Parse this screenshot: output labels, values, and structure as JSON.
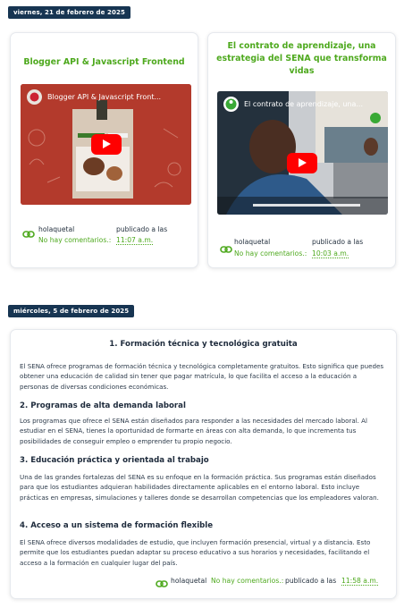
{
  "colors": {
    "accent": "#4ea91e",
    "badge": "#173552",
    "text": "#1e2b3c"
  },
  "date1": "viernes, 21 de febrero de 2025",
  "posts": [
    {
      "title": "Blogger API & Javascript Frontend",
      "video_title": "Blogger API & Javascript Front...",
      "author": "holaquetal",
      "comments": "No hay comentarios.:",
      "published_label": "publicado a las",
      "time": "11:07 a.m."
    },
    {
      "title": "El contrato de aprendizaje, una estrategia del SENA que transforma vidas",
      "video_title": "El contrato de aprendizaje, una...",
      "author": "holaquetal",
      "comments": "No hay comentarios.:",
      "published_label": "publicado a las",
      "time": "10:03 a.m."
    }
  ],
  "date2": "miércoles, 5 de febrero de 2025",
  "article": {
    "sections": [
      {
        "heading": "1. Formación técnica y tecnológica gratuita",
        "body": "El SENA ofrece programas de formación técnica y tecnológica completamente gratuitos. Esto significa que puedes obtener una educación de calidad sin tener que pagar matrícula, lo que facilita el acceso a la educación a personas de diversas condiciones económicas."
      },
      {
        "heading": "2. Programas de alta demanda laboral",
        "body": "Los programas que ofrece el SENA están diseñados para responder a las necesidades del mercado laboral. Al estudiar en el SENA, tienes la oportunidad de formarte en áreas con alta demanda, lo que incrementa tus posibilidades de conseguir empleo o emprender tu propio negocio."
      },
      {
        "heading": "3. Educación práctica y orientada al trabajo",
        "body": "Una de las grandes fortalezas del SENA es su enfoque en la formación práctica. Sus programas están diseñados para que los estudiantes adquieran habilidades directamente aplicables en el entorno laboral. Esto incluye prácticas en empresas, simulaciones y talleres donde se desarrollan competencias que los empleadores valoran."
      },
      {
        "heading": "4. Acceso a un sistema de formación flexible",
        "body": "El SENA ofrece diversos modalidades de estudio, que incluyen formación presencial, virtual y a distancia. Esto permite que los estudiantes puedan adaptar su proceso educativo a sus horarios y necesidades, facilitando el acceso a la formación en cualquier lugar del país."
      }
    ],
    "author": "holaquetal",
    "comments": "No hay comentarios.:",
    "published_label": "publicado a las",
    "time": "11:58 a.m."
  },
  "icons": {
    "link": "link-icon",
    "play": "play-icon"
  }
}
